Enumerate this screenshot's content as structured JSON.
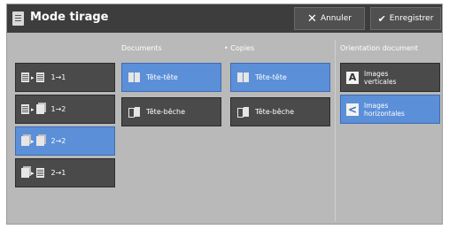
{
  "header": {
    "title": "Mode tirage",
    "cancel_label": "Annuler",
    "save_label": "Enregistrer"
  },
  "modes": [
    {
      "label": "1→1",
      "selected": false
    },
    {
      "label": "1→2",
      "selected": false
    },
    {
      "label": "2→2",
      "selected": true
    },
    {
      "label": "2→1",
      "selected": false
    }
  ],
  "documents": {
    "label": "Documents",
    "options": [
      {
        "label": "Tête-tête",
        "selected": true
      },
      {
        "label": "Tête-bêche",
        "selected": false
      }
    ]
  },
  "copies": {
    "label": "• Copies",
    "options": [
      {
        "label": "Tête-tête",
        "selected": true
      },
      {
        "label": "Tête-bêche",
        "selected": false
      }
    ]
  },
  "orientation": {
    "label": "Orientation document",
    "options": [
      {
        "icon": "A",
        "line1": "Images",
        "line2": "verticales",
        "selected": false
      },
      {
        "icon": "<",
        "line1": "Images",
        "line2": "horizontales",
        "selected": true
      }
    ]
  },
  "colors": {
    "selected": "#5b8fd8",
    "tile": "#4a4a4a",
    "titlebar": "#3d3d3d",
    "panel": "#b9b9b9"
  }
}
